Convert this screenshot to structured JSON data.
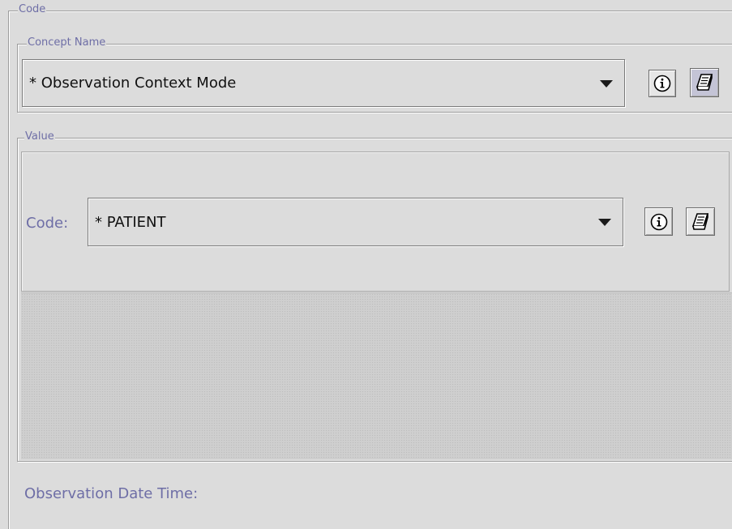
{
  "code_group": {
    "title": "Code"
  },
  "concept_name": {
    "title": "Concept Name",
    "selected_value": "* Observation Context Mode",
    "info_icon": "info-circle-icon",
    "edit_icon": "notebook-icon"
  },
  "value_group": {
    "title": "Value",
    "code_label": "Code:",
    "code_selected": "* PATIENT",
    "info_icon": "info-circle-icon",
    "edit_icon": "notebook-icon"
  },
  "observation_date_time": {
    "label": "Observation Date Time:"
  },
  "colors": {
    "background": "#dcdcdc",
    "label_text": "#6e6ea6",
    "pressed_button": "#c4c4d6"
  }
}
